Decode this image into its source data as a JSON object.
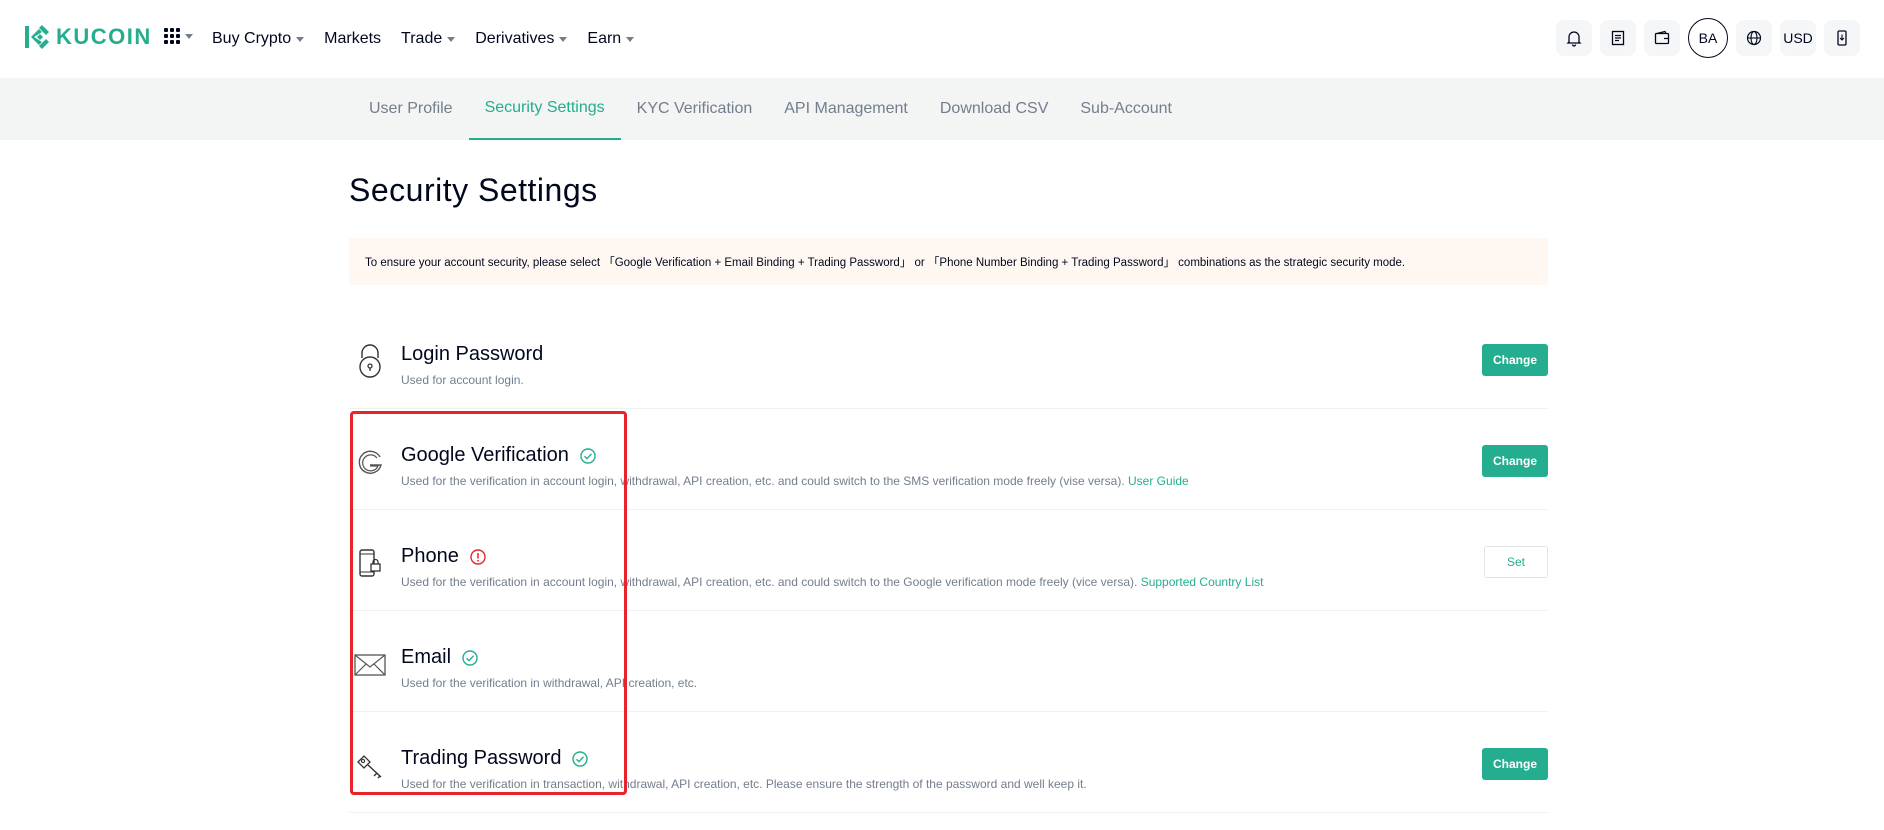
{
  "brand": {
    "name": "KUCOIN",
    "color": "#24ae8f"
  },
  "nav": {
    "items": [
      {
        "label": "Buy Crypto",
        "has_caret": true
      },
      {
        "label": "Markets",
        "has_caret": false
      },
      {
        "label": "Trade",
        "has_caret": true
      },
      {
        "label": "Derivatives",
        "has_caret": true
      },
      {
        "label": "Earn",
        "has_caret": true
      }
    ],
    "tools": [
      "bell-icon",
      "orders-icon",
      "wallet-icon"
    ],
    "avatar": "BA",
    "currency": "USD"
  },
  "subnav": {
    "tabs": [
      {
        "label": "User Profile"
      },
      {
        "label": "Security Settings",
        "active": true
      },
      {
        "label": "KYC Verification"
      },
      {
        "label": "API Management"
      },
      {
        "label": "Download CSV"
      },
      {
        "label": "Sub-Account"
      }
    ]
  },
  "page": {
    "title": "Security Settings",
    "notice": "To ensure your account security, please select 「Google Verification + Email Binding + Trading Password」 or 「Phone Number Binding + Trading Password」 combinations as the strategic security mode."
  },
  "settings": [
    {
      "name": "Login Password",
      "icon": "lock-icon",
      "status": "none",
      "desc": "Used for account login.",
      "link": "",
      "button": "Change",
      "button_style": "primary"
    },
    {
      "name": "Google Verification",
      "icon": "google-icon",
      "status": "ok",
      "desc": "Used for the verification in account login, withdrawal, API creation, etc. and could switch to the SMS verification mode freely (vise versa).",
      "link": "User Guide",
      "button": "Change",
      "button_style": "primary"
    },
    {
      "name": "Phone",
      "icon": "phone-icon",
      "status": "warning",
      "desc": "Used for the verification in account login, withdrawal, API creation, etc. and could switch to the Google verification mode freely (vice versa).",
      "link": "Supported Country List",
      "button": "Set",
      "button_style": "ghost"
    },
    {
      "name": "Email",
      "icon": "email-icon",
      "status": "ok",
      "desc": "Used for the verification in withdrawal, API creation, etc.",
      "link": "",
      "button": "",
      "button_style": ""
    },
    {
      "name": "Trading Password",
      "icon": "key-icon",
      "status": "ok",
      "desc": "Used for the verification in transaction, withdrawal, API creation, etc. Please ensure the strength of the password and well keep it.",
      "link": "",
      "button": "Change",
      "button_style": "primary"
    }
  ],
  "colors": {
    "accent": "#24ae8f",
    "warning": "#e8232b",
    "highlight": "#e8232b"
  }
}
